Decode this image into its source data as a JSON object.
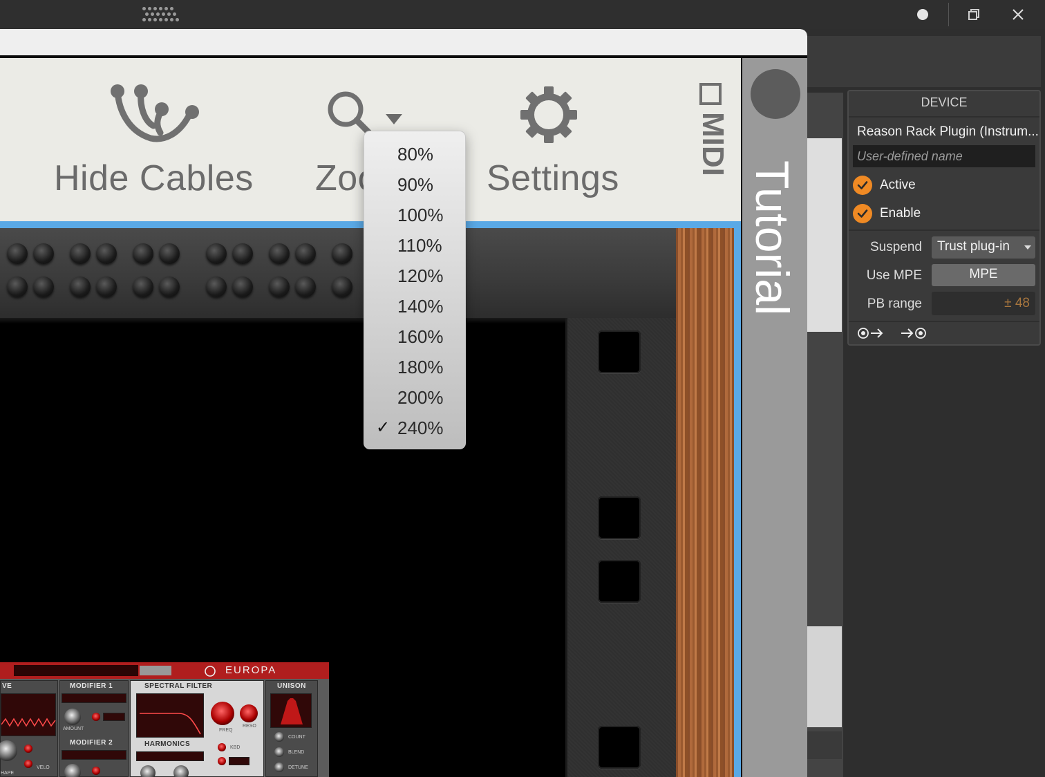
{
  "toolbar": {
    "hide_cables_label": "Hide Cables",
    "zoom_label": "Zoom",
    "settings_label": "Settings",
    "midi_label": "MIDI"
  },
  "zoom_menu": {
    "items": [
      {
        "label": "80%",
        "checked": false
      },
      {
        "label": "90%",
        "checked": false
      },
      {
        "label": "100%",
        "checked": false
      },
      {
        "label": "110%",
        "checked": false
      },
      {
        "label": "120%",
        "checked": false
      },
      {
        "label": "140%",
        "checked": false
      },
      {
        "label": "160%",
        "checked": false
      },
      {
        "label": "180%",
        "checked": false
      },
      {
        "label": "200%",
        "checked": false
      },
      {
        "label": "240%",
        "checked": true
      }
    ],
    "check_glyph": "✓"
  },
  "tutorial": {
    "label": "Tutorial"
  },
  "europa": {
    "logo": "EUROPA",
    "labels": {
      "ve": "VE",
      "modifier1": "MODIFIER 1",
      "modifier2": "MODIFIER 2",
      "spectral_filter": "SPECTRAL FILTER",
      "harmonics": "HARMONICS",
      "unison": "UNISON",
      "amount": "AMOUNT",
      "velo": "VELO",
      "hape": "HAPE",
      "freq": "FREQ",
      "reso": "RESO",
      "kbd": "KBD",
      "count": "COUNT",
      "blend": "BLEND",
      "detune": "DETUNE"
    }
  },
  "device_panel": {
    "title": "DEVICE",
    "plugin_name": "Reason Rack Plugin (Instrum...",
    "name_placeholder": "User-defined name",
    "active_label": "Active",
    "enable_label": "Enable",
    "suspend_label": "Suspend",
    "suspend_value": "Trust plug-in",
    "use_mpe_label": "Use MPE",
    "mpe_button": "MPE",
    "pb_range_label": "PB range",
    "pb_range_value": "± 48"
  },
  "colors": {
    "accent_blue": "#5aa9e6",
    "check_orange": "#f08a24",
    "europa_red": "#b01e1e",
    "pb_value": "#a8763e"
  },
  "icons": [
    "grip-icon",
    "record-dot-icon",
    "restore-window-icon",
    "close-icon",
    "cables-icon",
    "zoom-magnifier-icon",
    "dropdown-caret-icon",
    "gear-icon",
    "midi-checkbox-icon",
    "checkmark-icon",
    "audio-out-icon",
    "audio-in-icon"
  ]
}
